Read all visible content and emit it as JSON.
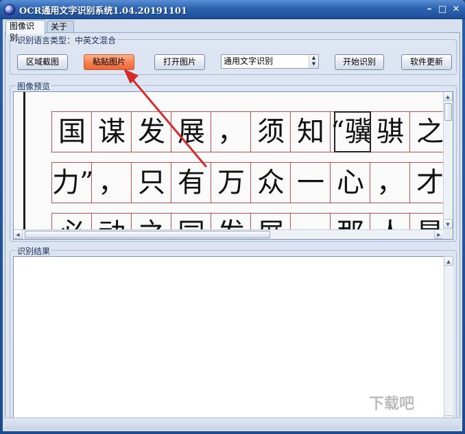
{
  "window": {
    "title": "OCR通用文字识别系统1.04.20191101"
  },
  "titlebar": {
    "min_glyph": "–",
    "max_glyph": "□",
    "close_glyph": "✕"
  },
  "tabs": [
    {
      "label": "图像识别"
    },
    {
      "label": "关于"
    }
  ],
  "toolbar": {
    "group_label": "识别语言类型：中英文混合",
    "region_label": "区域截图",
    "paste_label": "粘贴图片",
    "open_label": "打开图片",
    "mode_value": "通用文字识别",
    "start_label": "开始识别",
    "update_label": "软件更新"
  },
  "preview": {
    "group_label": "图像预览",
    "row1": [
      "国",
      "谋",
      "发",
      "展",
      "，",
      "须",
      "知",
      "“骥",
      "骐",
      "之"
    ],
    "row2": [
      "力”",
      "，",
      "只",
      "有",
      "万",
      "众",
      "一",
      "心",
      "，",
      "才"
    ],
    "row3": [
      "必",
      "动",
      "之",
      "同",
      "发",
      "展",
      "",
      "那",
      "人",
      "是"
    ]
  },
  "result": {
    "group_label": "识别结果",
    "text": ""
  },
  "watermark": "下载吧",
  "colors": {
    "accent_paste": "#f7804f",
    "arrow": "#d42a2a",
    "titlebar": "#2c63b0"
  }
}
